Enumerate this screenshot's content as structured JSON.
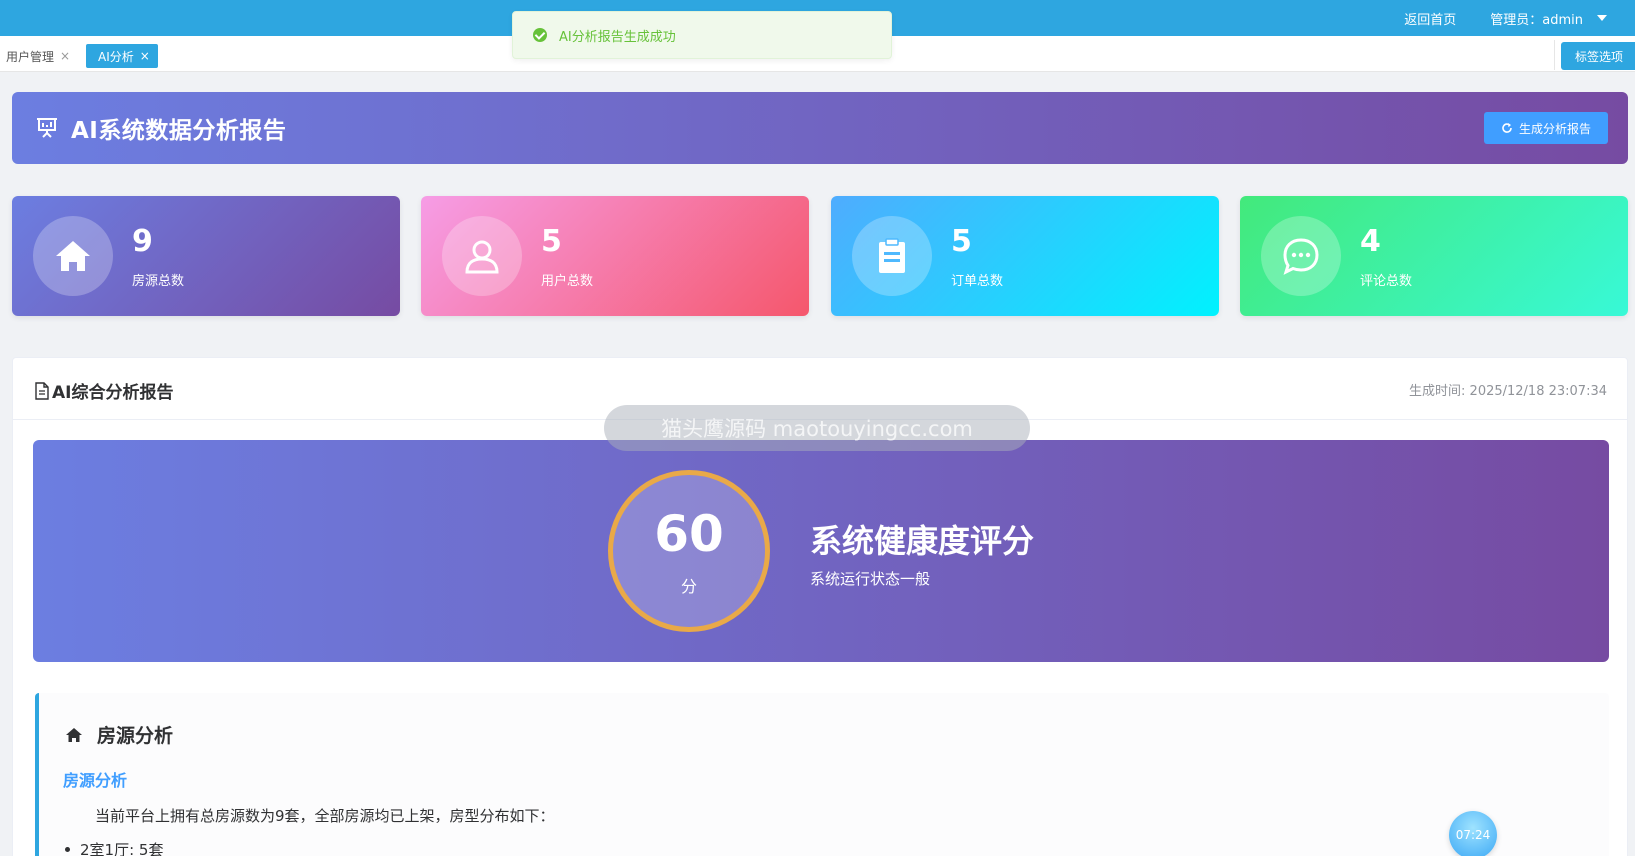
{
  "topbar": {
    "home_link": "返回首页",
    "admin_label": "管理员：admin"
  },
  "tabs": [
    {
      "label": "用户管理",
      "close": "×",
      "active": false
    },
    {
      "label": "AI分析",
      "close": "×",
      "active": true
    }
  ],
  "tab_options": "标签选项",
  "toast": {
    "message": "AI分析报告生成成功",
    "type": "success"
  },
  "banner": {
    "title": "AI系统数据分析报告",
    "button_label": "生成分析报告",
    "icon": "presentation-icon"
  },
  "stats": [
    {
      "value": "9",
      "label": "房源总数",
      "icon": "home-icon"
    },
    {
      "value": "5",
      "label": "用户总数",
      "icon": "user-icon"
    },
    {
      "value": "5",
      "label": "订单总数",
      "icon": "clipboard-icon"
    },
    {
      "value": "4",
      "label": "评论总数",
      "icon": "chat-icon"
    }
  ],
  "report": {
    "title": "AI综合分析报告",
    "time": "生成时间: 2025/12/18 23:07:34",
    "health": {
      "score": "60",
      "unit": "分",
      "title": "系统健康度评分",
      "subtitle": "系统运行状态一般"
    },
    "section": {
      "title": "房源分析",
      "subtitle": "房源分析",
      "paragraph": "当前平台上拥有总房源数为9套，全部房源均已上架，房型分布如下：",
      "list_item": "2室1厅: 5套"
    }
  },
  "watermark": "猫头鹰源码 maotouyingcc.com",
  "clock": "07:24",
  "colors": {
    "primary": "#2ea6e0",
    "accent_blue": "#409eff",
    "success": "#67c23a",
    "ring": "#e9a948"
  }
}
